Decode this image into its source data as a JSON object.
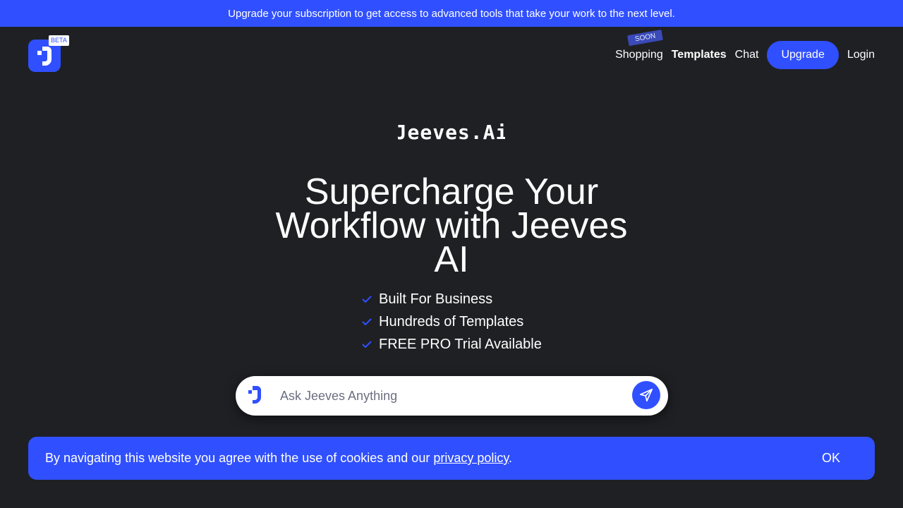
{
  "promo_banner": {
    "text": "Upgrade your subscription to get access to advanced tools that take your work to the next level."
  },
  "header": {
    "logo_icon": "jeeves-logo-icon",
    "beta_label": "BETA",
    "soon_label": "SOON",
    "nav": {
      "shopping": "Shopping",
      "templates": "Templates",
      "chat": "Chat",
      "upgrade": "Upgrade",
      "login": "Login"
    }
  },
  "hero": {
    "wordmark": "Jeeves.Ai",
    "headline": "Supercharge Your Workflow with Jeeves AI",
    "features": [
      "Built For Business",
      "Hundreds of Templates",
      "FREE PRO Trial Available"
    ]
  },
  "search": {
    "placeholder": "Ask Jeeves Anything",
    "value": "",
    "send_icon": "send-icon"
  },
  "cookie_banner": {
    "text_before": "By navigating this website you agree with the use of cookies and our ",
    "link_text": "privacy policy",
    "text_after": ".",
    "ok_label": "OK"
  },
  "colors": {
    "background": "#1f2024",
    "accent": "#3050ff",
    "text": "#ffffff"
  }
}
